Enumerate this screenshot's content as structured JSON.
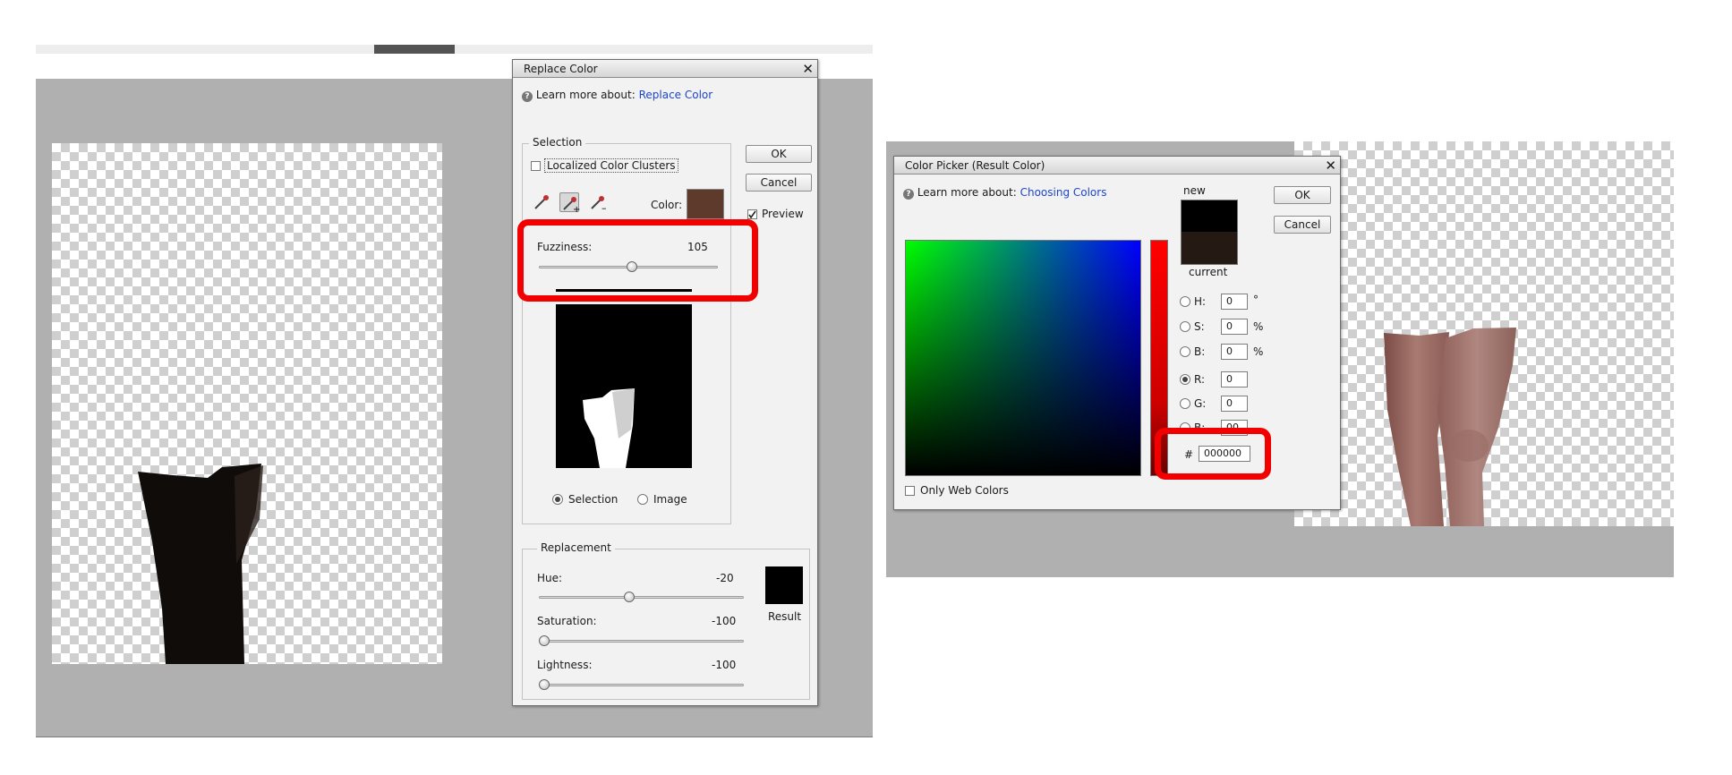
{
  "replace_color": {
    "title": "Replace Color",
    "learn_prefix": "Learn more about:",
    "learn_link": "Replace Color",
    "selection_group": "Selection",
    "localized_clusters": "Localized Color Clusters",
    "color_label": "Color:",
    "color_swatch": "#5d3a2b",
    "ok": "OK",
    "cancel": "Cancel",
    "preview": "Preview",
    "preview_checked": true,
    "fuzziness_label": "Fuzziness:",
    "fuzziness_value": "105",
    "fuzziness_fraction": 0.52,
    "mode_selection": "Selection",
    "mode_image": "Image",
    "replacement_group": "Replacement",
    "hue_label": "Hue:",
    "hue_value": "-20",
    "hue_fraction": 0.44,
    "saturation_label": "Saturation:",
    "saturation_value": "-100",
    "saturation_fraction": 0.0,
    "lightness_label": "Lightness:",
    "lightness_value": "-100",
    "lightness_fraction": 0.0,
    "result_label": "Result",
    "result_color": "#000000"
  },
  "color_picker": {
    "title": "Color Picker (Result Color)",
    "learn_prefix": "Learn more about:",
    "learn_link": "Choosing Colors",
    "new_label": "new",
    "current_label": "current",
    "new_color": "#000000",
    "current_color": "#241a13",
    "ok": "OK",
    "cancel": "Cancel",
    "h_label": "H:",
    "h_value": "0",
    "h_unit": "°",
    "s_label": "S:",
    "s_value": "0",
    "s_unit": "%",
    "b_label": "B:",
    "b_value": "0",
    "b_unit": "%",
    "r_label": "R:",
    "r_value": "0",
    "g_label": "G:",
    "g_value": "0",
    "b2_label": "B:",
    "b2_value": "00",
    "hex_label": "#",
    "hex_value": "000000",
    "only_web_colors": "Only Web Colors"
  },
  "icons": [
    "close-icon",
    "help-icon",
    "eyedropper-icon",
    "eyedropper-add-icon",
    "eyedropper-subtract-icon"
  ],
  "accent": "#f20000"
}
